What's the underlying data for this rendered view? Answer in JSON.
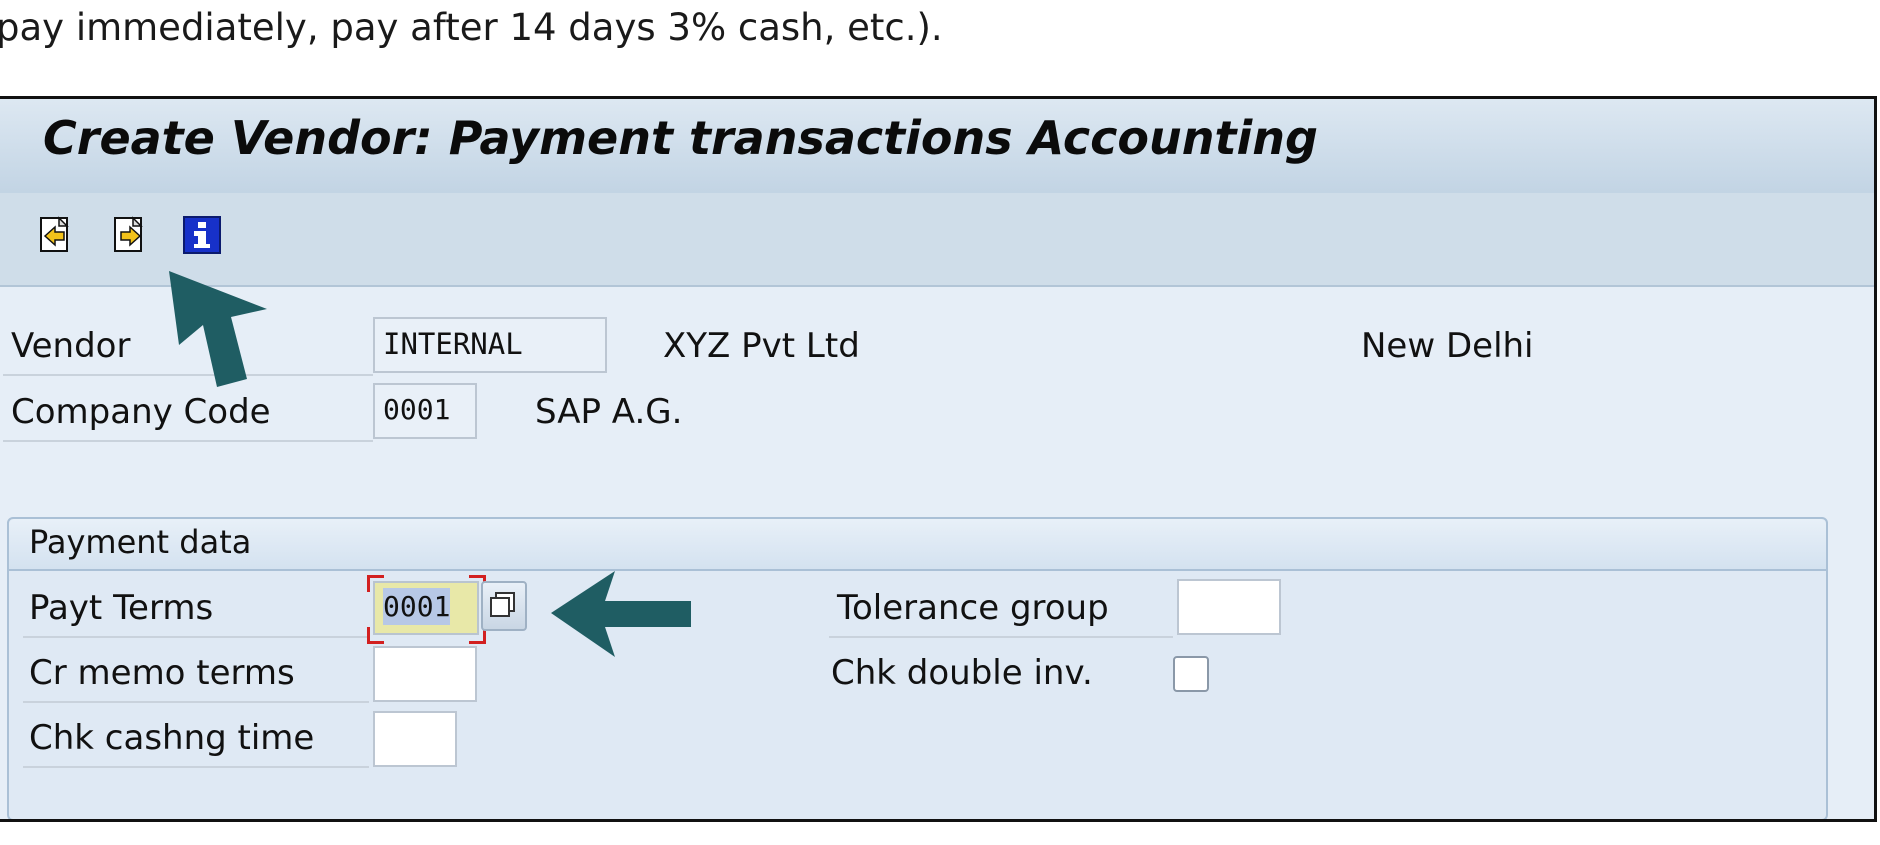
{
  "caption": "pay immediately, pay after 14 days 3% cash, etc.).",
  "window": {
    "title": "Create Vendor: Payment transactions Accounting"
  },
  "toolbar": {
    "buttons": [
      "previous-screen-icon",
      "next-screen-icon",
      "info-icon"
    ]
  },
  "header_fields": {
    "vendor": {
      "label": "Vendor",
      "value": "INTERNAL",
      "name": "XYZ Pvt Ltd",
      "city": "New Delhi"
    },
    "company_code": {
      "label": "Company Code",
      "value": "0001",
      "name": "SAP A.G."
    }
  },
  "payment_data": {
    "title": "Payment data",
    "payt_terms": {
      "label": "Payt Terms",
      "value": "0001"
    },
    "cr_memo_terms": {
      "label": "Cr memo terms",
      "value": ""
    },
    "chk_cashng_time": {
      "label": "Chk cashng time",
      "value": ""
    },
    "tolerance_group": {
      "label": "Tolerance group",
      "value": ""
    },
    "chk_double_inv": {
      "label": "Chk double inv.",
      "checked": false
    }
  },
  "colors": {
    "annotation_arrow": "#1f5d63",
    "focus_frame": "#d22020",
    "title_bar": "#c2d4e4"
  }
}
